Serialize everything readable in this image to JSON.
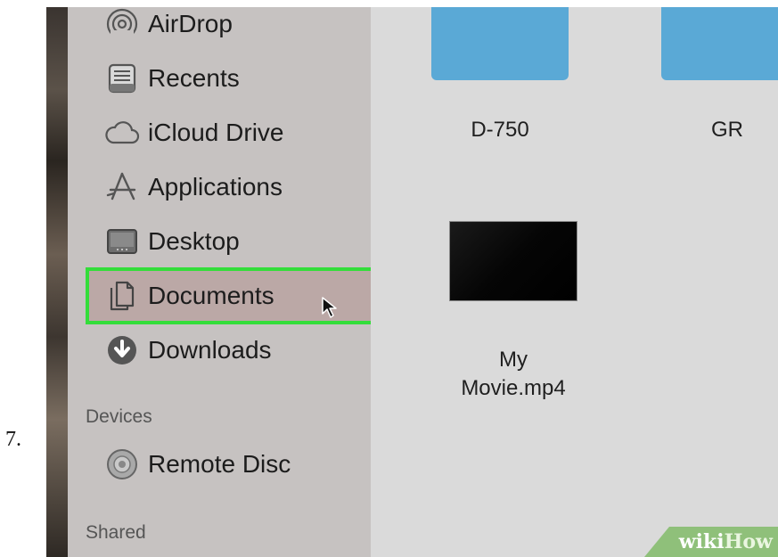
{
  "step_number": "7.",
  "sidebar": {
    "favorites": [
      {
        "label": "AirDrop",
        "icon": "airdrop-icon"
      },
      {
        "label": "Recents",
        "icon": "recents-icon"
      },
      {
        "label": "iCloud Drive",
        "icon": "cloud-icon"
      },
      {
        "label": "Applications",
        "icon": "applications-icon"
      },
      {
        "label": "Desktop",
        "icon": "desktop-icon"
      },
      {
        "label": "Documents",
        "icon": "documents-icon",
        "selected": true
      },
      {
        "label": "Downloads",
        "icon": "download-icon"
      }
    ],
    "devices_header": "Devices",
    "devices": [
      {
        "label": "Remote Disc",
        "icon": "disc-icon"
      }
    ],
    "shared_header": "Shared"
  },
  "files": [
    {
      "name": "D-750",
      "type": "folder"
    },
    {
      "name": "GR",
      "type": "folder"
    },
    {
      "name_line1": "My",
      "name_line2": "Movie.mp4",
      "type": "video"
    }
  ],
  "colors": {
    "highlight_border": "#33dd3a",
    "folder": "#5aa9d6",
    "sidebar": "#c6c2c1"
  },
  "watermark": {
    "prefix": "wiki",
    "suffix": "How"
  }
}
